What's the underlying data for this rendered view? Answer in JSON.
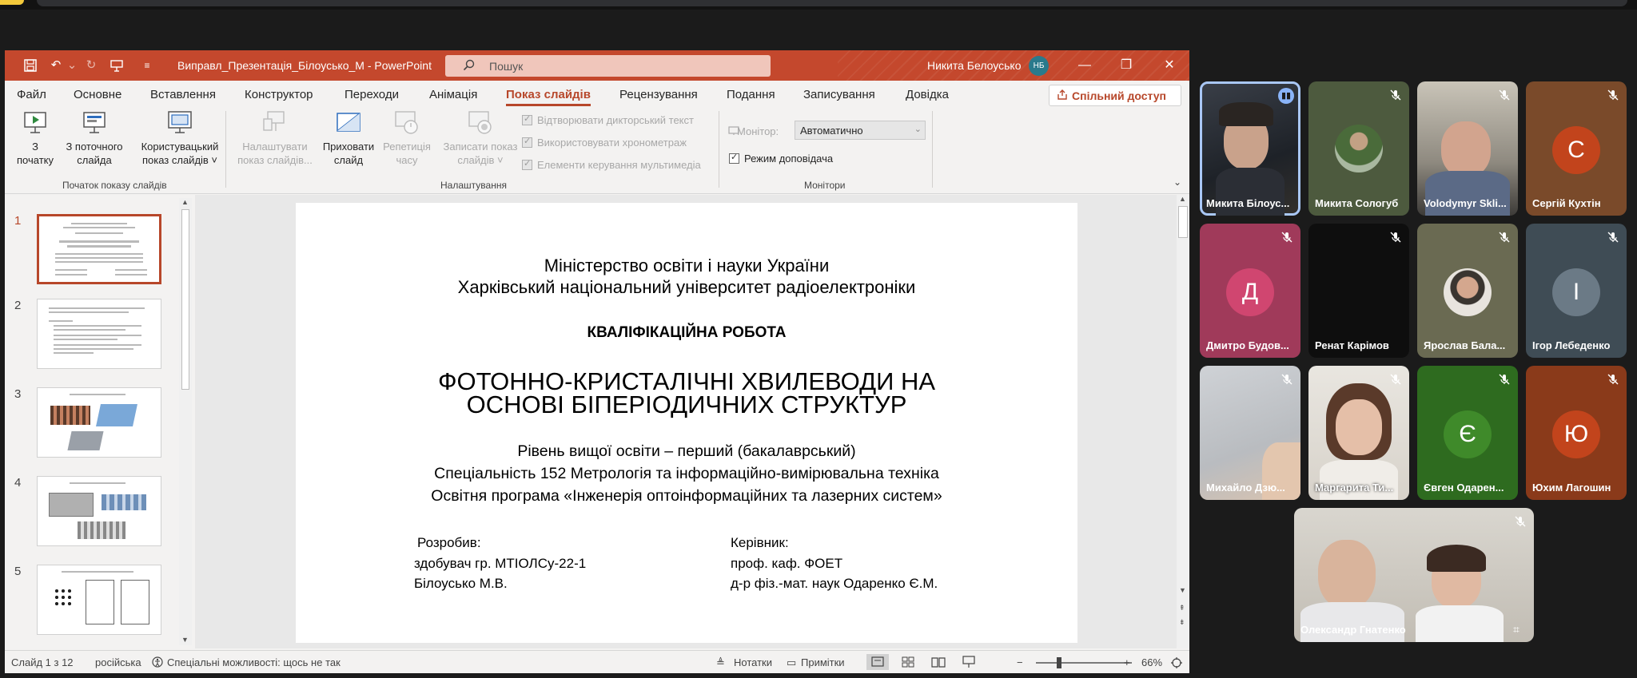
{
  "window": {
    "doc_title": "Виправл_Презентація_Білоусько_М  -  PowerPoint",
    "search_placeholder": "Пошук",
    "user_name": "Никита Белоусько",
    "user_initials": "НБ"
  },
  "menu": {
    "tabs": [
      "Файл",
      "Основне",
      "Вставлення",
      "Конструктор",
      "Переходи",
      "Анімація",
      "Показ слайдів",
      "Рецензування",
      "Подання",
      "Записування",
      "Довідка"
    ],
    "active_tab": "Показ слайдів",
    "share_label": "Спільний доступ"
  },
  "ribbon": {
    "from_start": "З\nпочатку",
    "from_current": "З поточного\nслайда",
    "custom_show": "Користувацький\nпоказ слайдів ˅",
    "group_start": "Початок показу слайдів",
    "setup_show": "Налаштувати\nпоказ слайдів...",
    "hide_slide": "Приховати\nслайд",
    "rehearse": "Репетиція\nчасу",
    "record": "Записати показ\nслайдів ˅",
    "play_narration": "Відтворювати дикторський текст",
    "use_timings": "Використовувати хронометраж",
    "show_media_controls": "Елементи керування мультимедіа",
    "group_setup": "Налаштування",
    "monitor_label": "Монітор:",
    "monitor_value": "Автоматично",
    "presenter_view": "Режим доповідача",
    "group_monitors": "Монітори"
  },
  "thumbnails": [
    "1",
    "2",
    "3",
    "4",
    "5"
  ],
  "slide": {
    "line1": "Міністерство освіти і науки України",
    "line2": "Харківський національний університет радіоелектроніки",
    "work_type": "КВАЛІФІКАЦІЙНА РОБОТА",
    "title1": "ФОТОННО-КРИСТАЛІЧНІ ХВИЛЕВОДИ НА",
    "title2": "ОСНОВІ БІПЕРІОДИЧНИХ СТРУКТУР",
    "level": "Рівень вищої освіти – перший (бакалаврський)",
    "specialty": "Спеціальність 152 Метрологія та інформаційно-вимірювальна техніка",
    "program": "Освітня програма «Інженерія оптоінформаційних та лазерних систем»",
    "developer_label": "Розробив:",
    "developer_group": "здобувач гр. МТІОЛСу-22-1",
    "developer_name": "Білоусько  М.В.",
    "supervisor_label": "Керівник:",
    "supervisor_position": "проф. каф. ФОЕТ",
    "supervisor_name": "д-р фіз.-мат. наук  Одаренко Є.М."
  },
  "status": {
    "slide_counter": "Слайд 1 з 12",
    "language": "російська",
    "accessibility": "Спеціальні можливості: щось не так",
    "notes": "Нотатки",
    "comments": "Примітки",
    "zoom": "66%"
  },
  "participants": [
    {
      "name": "Микита Білоус...",
      "type": "video",
      "speaking": true
    },
    {
      "name": "Микита Сологуб",
      "type": "photo"
    },
    {
      "name": "Volodymyr Skli...",
      "type": "video"
    },
    {
      "name": "Сергій Кухтін",
      "type": "letter",
      "letter": "С",
      "color": "#c2441c",
      "bg": "#7a4a2a"
    },
    {
      "name": "Дмитро Будов...",
      "type": "letter",
      "letter": "Д",
      "color": "#d04670",
      "bg": "#a03a5a"
    },
    {
      "name": "Ренат Карімов",
      "type": "dark"
    },
    {
      "name": "Ярослав Бала...",
      "type": "photo"
    },
    {
      "name": "Ігор Лебеденко",
      "type": "letter",
      "letter": "І",
      "color": "#6b7a86",
      "bg": "#3f4c55"
    },
    {
      "name": "Михайло Дзю...",
      "type": "video"
    },
    {
      "name": "Маргарита Ти...",
      "type": "video"
    },
    {
      "name": "Євген Одарен...",
      "type": "letter",
      "letter": "Є",
      "color": "#3f8a2a",
      "bg": "#2e6b1f"
    },
    {
      "name": "Юхим Лагошин",
      "type": "letter",
      "letter": "Ю",
      "color": "#c2441c",
      "bg": "#8a3a1a"
    },
    {
      "name": "Олександр Гнатенко",
      "type": "video"
    }
  ]
}
